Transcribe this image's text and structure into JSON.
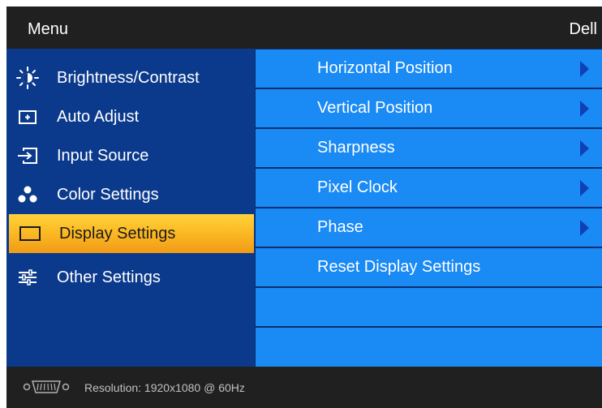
{
  "header": {
    "title": "Menu",
    "brand": "Dell"
  },
  "sidebar": {
    "items": [
      {
        "label": "Brightness/Contrast",
        "icon": "brightness-icon"
      },
      {
        "label": "Auto Adjust",
        "icon": "auto-adjust-icon"
      },
      {
        "label": "Input Source",
        "icon": "input-source-icon"
      },
      {
        "label": "Color Settings",
        "icon": "color-settings-icon"
      },
      {
        "label": "Display Settings",
        "icon": "display-settings-icon",
        "selected": true
      },
      {
        "label": "Other Settings",
        "icon": "other-settings-icon"
      }
    ]
  },
  "display_settings": {
    "rows": [
      {
        "label": "Horizontal Position",
        "has_submenu": true
      },
      {
        "label": "Vertical Position",
        "has_submenu": true
      },
      {
        "label": "Sharpness",
        "has_submenu": true
      },
      {
        "label": "Pixel Clock",
        "has_submenu": true
      },
      {
        "label": "Phase",
        "has_submenu": true
      },
      {
        "label": "Reset Display Settings",
        "has_submenu": false
      },
      {
        "label": "",
        "has_submenu": false
      },
      {
        "label": "",
        "has_submenu": false
      }
    ]
  },
  "footer": {
    "connector_icon": "vga-connector-icon",
    "resolution": "Resolution: 1920x1080 @ 60Hz"
  },
  "colors": {
    "header_bg": "#202020",
    "sidebar_bg": "#0b3a8d",
    "row_bg": "#1a8af5",
    "selected_bg": "#fbb823",
    "arrow": "#1040b8"
  }
}
